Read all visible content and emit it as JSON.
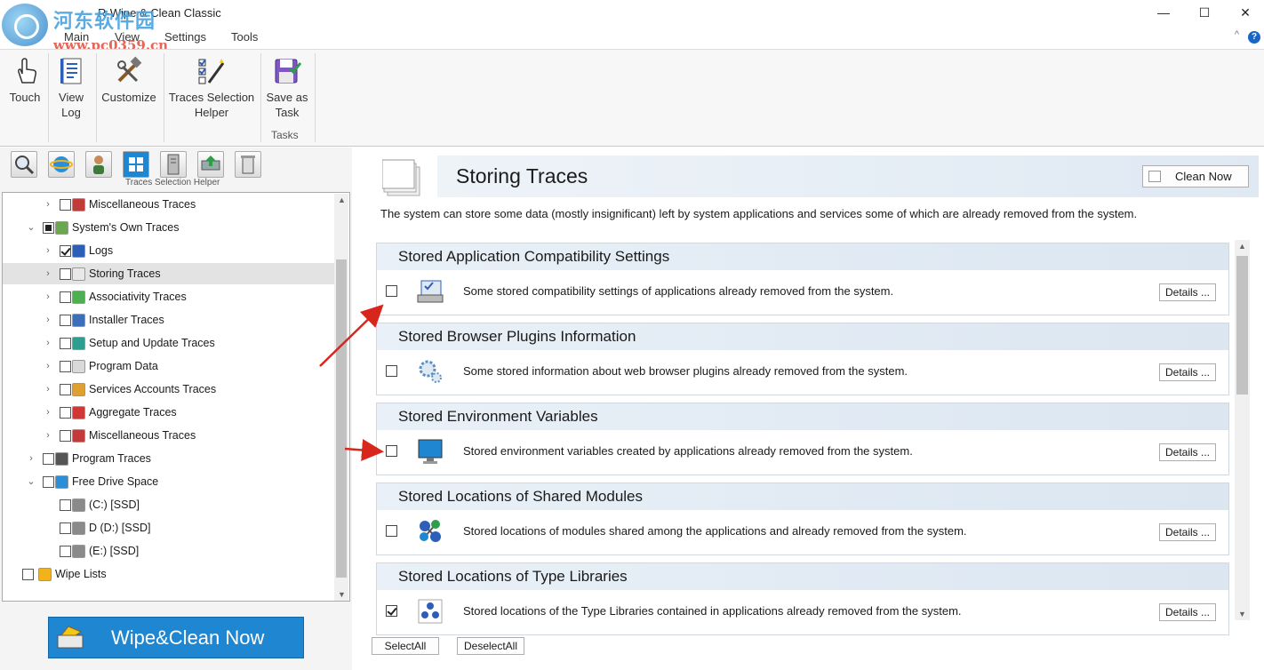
{
  "window": {
    "title": "R-Wipe & Clean Classic",
    "watermark_site": "河东软件园",
    "watermark_url": "www.pc0359.cn",
    "minimize": "—",
    "maximize": "☐",
    "close": "✕"
  },
  "menu": [
    "Main",
    "View",
    "Settings",
    "Tools"
  ],
  "ribbon": {
    "collapse_glyph": "^",
    "help_glyph": "?",
    "buttons": [
      {
        "label_line1": "Touch",
        "label_line2": "",
        "icon": "touch-icon"
      },
      {
        "label_line1": "View",
        "label_line2": "Log",
        "icon": "view-log-icon"
      },
      {
        "label_line1": "Customize",
        "label_line2": "",
        "icon": "customize-icon"
      },
      {
        "label_line1": "Traces Selection",
        "label_line2": "Helper",
        "icon": "traces-helper-icon"
      },
      {
        "label_line1": "Save as",
        "label_line2": "Task",
        "icon": "save-task-icon"
      }
    ],
    "group_label": "Tasks"
  },
  "toolbar": {
    "helper_label": "Traces Selection Helper",
    "icons": [
      "search-traces-icon",
      "internet-icon",
      "user-icon",
      "windows-icon",
      "server-icon",
      "drive-icon",
      "recycle-icon"
    ]
  },
  "tree": [
    {
      "label": "Miscellaneous Traces",
      "checked": "none",
      "arrow": "›",
      "level": 2,
      "color": "#c23b3b"
    },
    {
      "label": "System's Own Traces",
      "checked": "partial",
      "arrow": "⌄",
      "level": 1,
      "color": "#6aa84f"
    },
    {
      "label": "Logs",
      "checked": "checked",
      "arrow": "›",
      "level": 2,
      "color": "#2d5fb8"
    },
    {
      "label": "Storing Traces",
      "checked": "none",
      "arrow": "›",
      "level": 2,
      "color": "#e8e8e8",
      "selected": true
    },
    {
      "label": "Associativity Traces",
      "checked": "none",
      "arrow": "›",
      "level": 2,
      "color": "#4caf50"
    },
    {
      "label": "Installer Traces",
      "checked": "none",
      "arrow": "›",
      "level": 2,
      "color": "#3d6fb8"
    },
    {
      "label": "Setup and Update Traces",
      "checked": "none",
      "arrow": "›",
      "level": 2,
      "color": "#2e9e8e"
    },
    {
      "label": "Program Data",
      "checked": "none",
      "arrow": "›",
      "level": 2,
      "color": "#d9d9d9"
    },
    {
      "label": "Services Accounts Traces",
      "checked": "none",
      "arrow": "›",
      "level": 2,
      "color": "#e0a030"
    },
    {
      "label": "Aggregate Traces",
      "checked": "none",
      "arrow": "›",
      "level": 2,
      "color": "#d03838"
    },
    {
      "label": "Miscellaneous Traces",
      "checked": "none",
      "arrow": "›",
      "level": 2,
      "color": "#c23b3b"
    },
    {
      "label": "Program Traces",
      "checked": "none",
      "arrow": "›",
      "level": 1,
      "color": "#555555"
    },
    {
      "label": "Free Drive Space",
      "checked": "none",
      "arrow": "⌄",
      "level": 1,
      "color": "#2a8fd6"
    },
    {
      "label": "(C:) [SSD]",
      "checked": "none",
      "arrow": "",
      "level": 2,
      "color": "#8a8a8a"
    },
    {
      "label": "D  (D:) [SSD]",
      "checked": "none",
      "arrow": "",
      "level": 2,
      "color": "#8a8a8a"
    },
    {
      "label": "(E:) [SSD]",
      "checked": "none",
      "arrow": "",
      "level": 2,
      "color": "#8a8a8a"
    },
    {
      "label": "Wipe Lists",
      "checked": "none",
      "arrow": "",
      "level": 0,
      "color": "#f2b21c"
    }
  ],
  "wipe_button": "Wipe&Clean Now",
  "content": {
    "title": "Storing Traces",
    "clean_now": "Clean Now",
    "description": "The system can store some data (mostly insignificant) left by system applications and services some of which are already removed from the system.",
    "groups": [
      {
        "title": "Stored Application Compatibility Settings",
        "text": "Some stored compatibility settings of applications already removed from the system.",
        "checked": false,
        "icon": "compat-settings-icon",
        "details": "Details ..."
      },
      {
        "title": "Stored Browser Plugins Information",
        "text": "Some stored information about web browser plugins already removed from the system.",
        "checked": false,
        "icon": "gears-icon",
        "details": "Details ..."
      },
      {
        "title": "Stored Environment Variables",
        "text": "Stored environment variables created by applications already removed from the system.",
        "checked": false,
        "icon": "monitor-icon",
        "details": "Details ..."
      },
      {
        "title": "Stored Locations of Shared Modules",
        "text": "Stored locations of modules shared among the applications and already removed from the system.",
        "checked": false,
        "icon": "molecule-icon",
        "details": "Details ..."
      },
      {
        "title": "Stored Locations of Type Libraries",
        "text": "Stored locations of the Type Libraries contained in applications already removed from the system.",
        "checked": true,
        "icon": "library-icon",
        "details": "Details ..."
      }
    ],
    "select_all": "SelectAll",
    "deselect_all": "DeselectAll"
  }
}
